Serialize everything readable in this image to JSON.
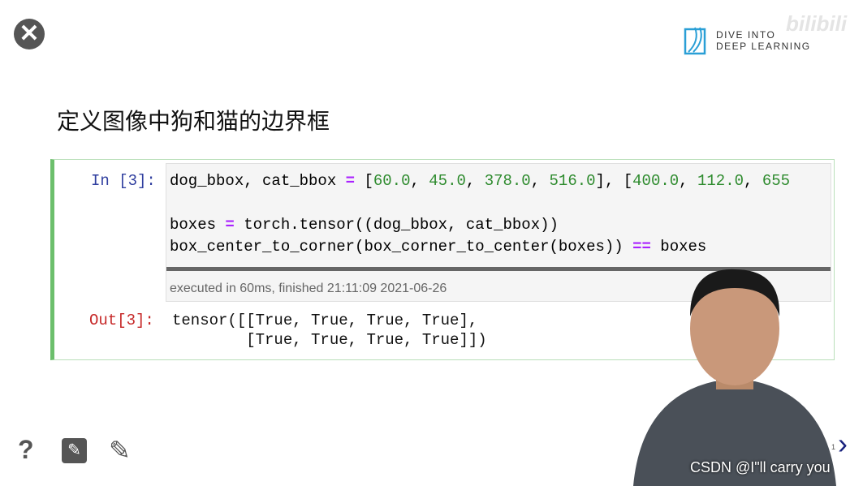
{
  "slide_title": "定义图像中狗和猫的边界框",
  "logo": {
    "line1": "DIVE INTO",
    "line2": "DEEP LEARNING"
  },
  "bilibili": "bilibili",
  "cell": {
    "in_prompt": "In [3]:",
    "code": {
      "l1_a": "dog_bbox, cat_bbox ",
      "l1_eq": "=",
      "l1_b": " [",
      "n1": "60.0",
      "n2": "45.0",
      "n3": "378.0",
      "n4": "516.0",
      "n5": "400.0",
      "n6": "112.0",
      "n7": "655",
      "l2_a": "boxes ",
      "l2_eq": "=",
      "l2_b": " torch.tensor((dog_bbox, cat_bbox))",
      "l3_a": "box_center_to_corner(box_corner_to_center(boxes)) ",
      "l3_eq": "==",
      "l3_b": " boxes"
    },
    "executed": "executed in 60ms, finished 21:11:09 2021-06-26",
    "out_prompt": "Out[3]:",
    "output_l1": "tensor([[True, True, True, True],",
    "output_l2": "        [True, True, True, True]])"
  },
  "page_number": "1",
  "watermark": "CSDN @I\"ll  carry  you",
  "icons": [
    "close-icon",
    "help-icon",
    "edit-box-icon",
    "pencil-icon",
    "next-arrow-icon"
  ]
}
